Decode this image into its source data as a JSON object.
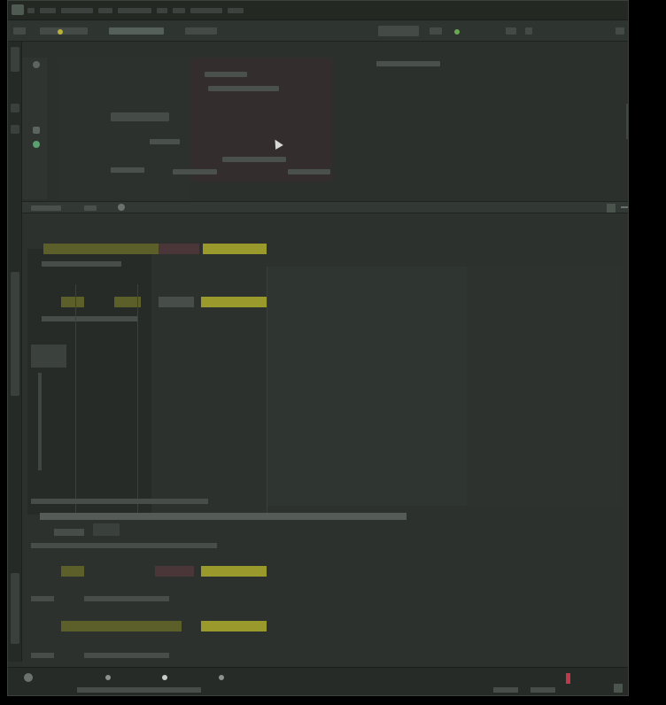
{
  "window": {
    "menu_items": [
      "",
      "",
      "",
      "",
      "",
      "",
      "",
      "",
      ""
    ]
  },
  "status": {
    "tabs": [
      {
        "label": "",
        "icon": "wrench-icon"
      },
      {
        "label": "",
        "icon": "clock-icon"
      },
      {
        "label": "",
        "icon": "info-icon"
      }
    ]
  },
  "colors": {
    "background": "#2a302b",
    "accent_yellow": "#9a9a2c",
    "accent_olive": "#5c5f2a",
    "accent_maroon": "#4a3538",
    "status_red": "#c0394a",
    "status_green": "#6aa84f"
  }
}
